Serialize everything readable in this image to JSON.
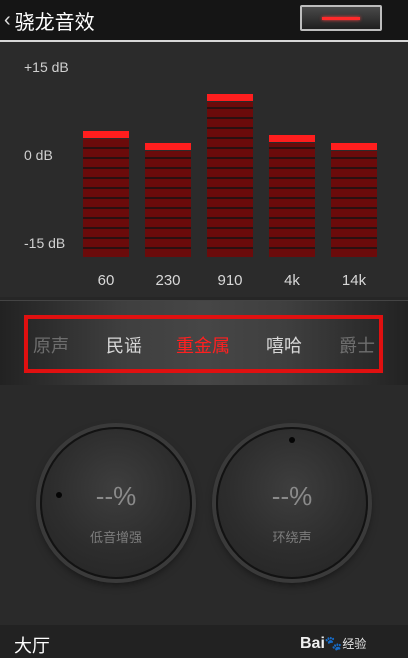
{
  "header": {
    "back_icon": "‹",
    "title": "骁龙音效"
  },
  "eq": {
    "db_labels": [
      "+15 dB",
      "0 dB",
      "-15 dB"
    ],
    "bands": [
      {
        "freq": "60",
        "level_db": 6
      },
      {
        "freq": "230",
        "level_db": 3
      },
      {
        "freq": "910",
        "level_db": 15
      },
      {
        "freq": "4k",
        "level_db": 5
      },
      {
        "freq": "14k",
        "level_db": 3
      }
    ],
    "cap_color": "#ff1e1e"
  },
  "presets": {
    "items": [
      {
        "label": "原声",
        "state": "dim"
      },
      {
        "label": "民谣",
        "state": "bright"
      },
      {
        "label": "重金属",
        "state": "active"
      },
      {
        "label": "嘻哈",
        "state": "bright"
      },
      {
        "label": "爵士",
        "state": "dim"
      }
    ],
    "active": "重金属",
    "highlight_color": "#e01010"
  },
  "knobs": {
    "bass": {
      "value": "--%",
      "label": "低音增强"
    },
    "surround": {
      "value": "--%",
      "label": "环绕声"
    }
  },
  "footer": {
    "mode": "大厅",
    "watermark": {
      "brand": "Bai",
      "icon": "paw-icon",
      "text": "经验"
    }
  }
}
